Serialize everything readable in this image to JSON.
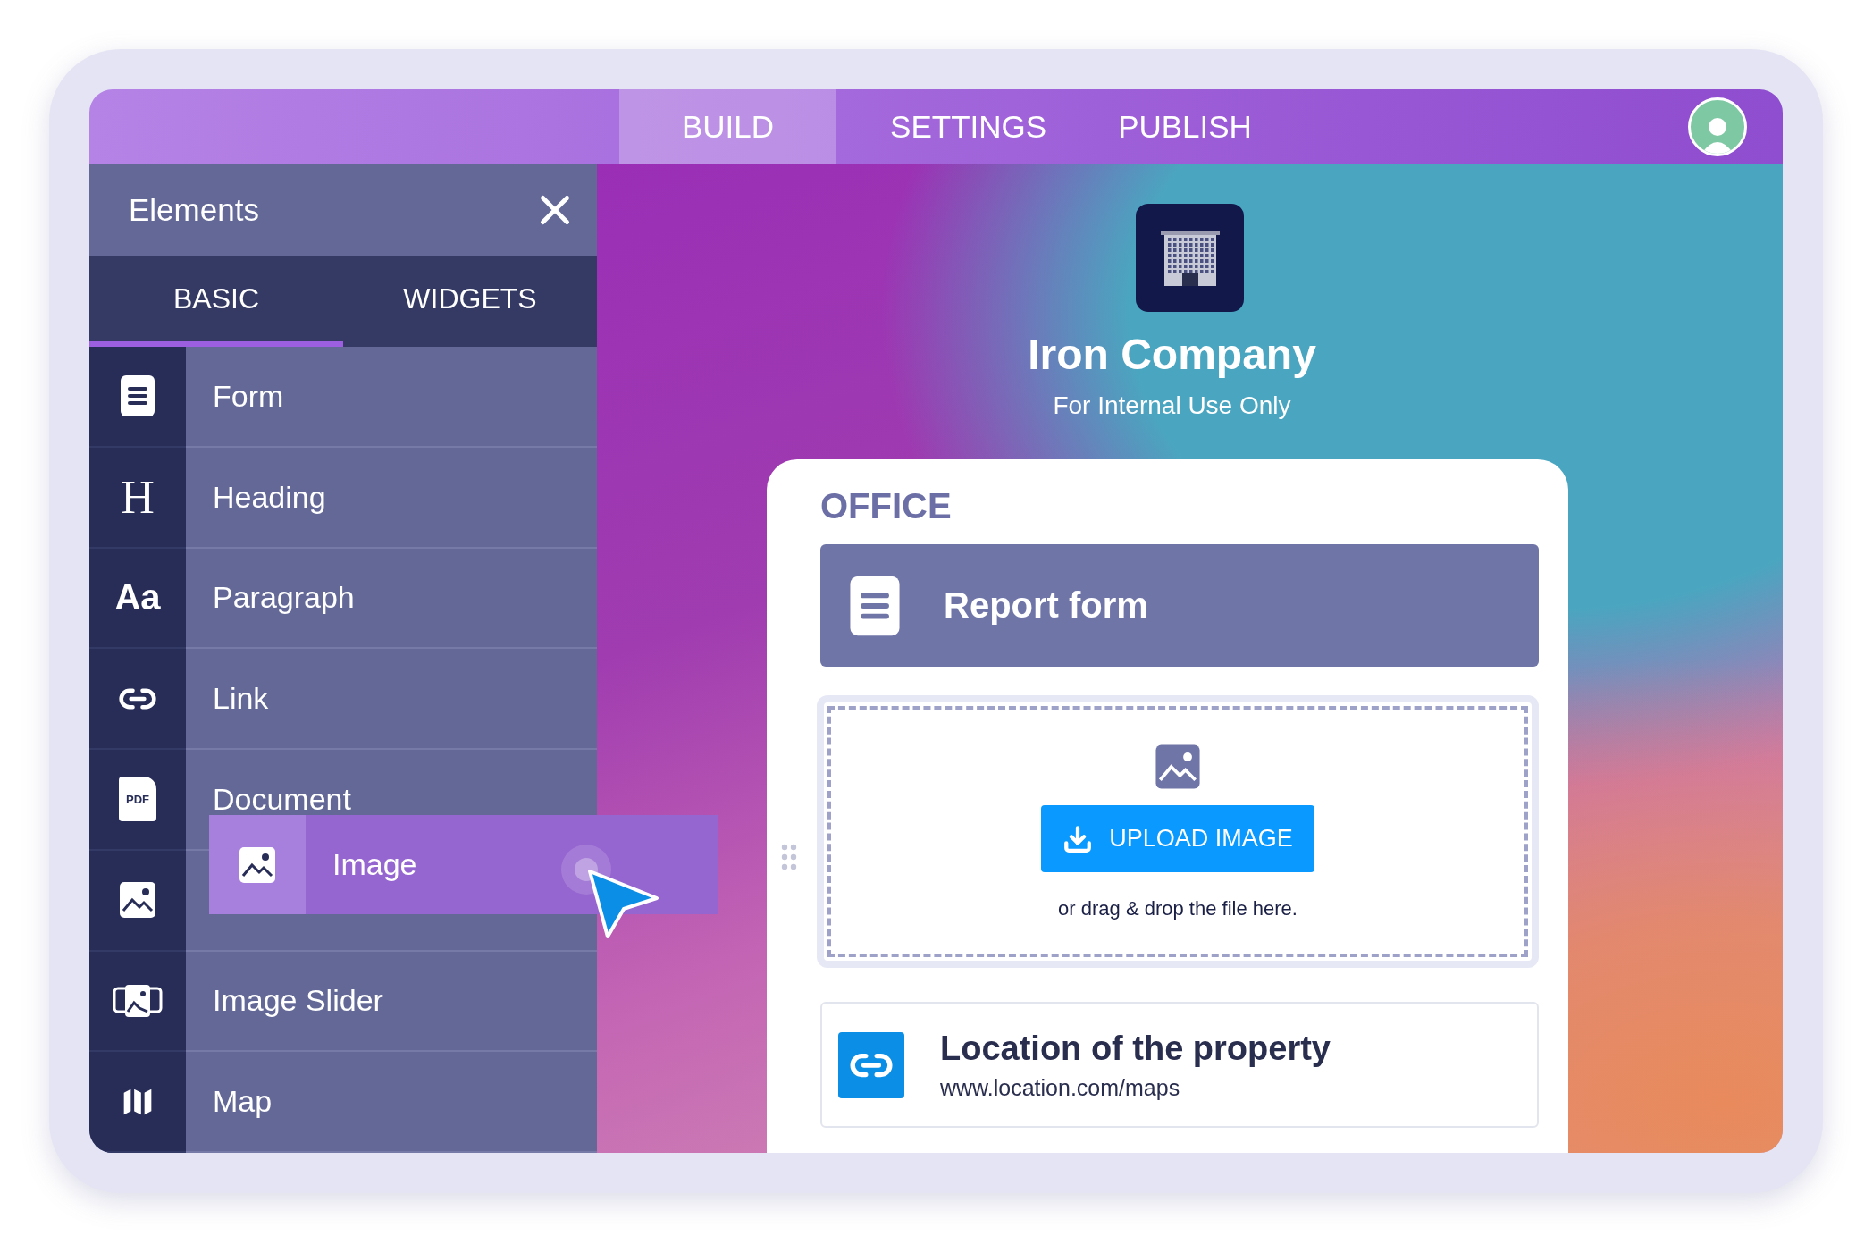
{
  "top_tabs": [
    {
      "label": "BUILD",
      "selected": true
    },
    {
      "label": "SETTINGS",
      "selected": false
    },
    {
      "label": "PUBLISH",
      "selected": false
    }
  ],
  "panel": {
    "title": "Elements",
    "tabs": [
      {
        "label": "BASIC",
        "selected": true
      },
      {
        "label": "WIDGETS",
        "selected": false
      }
    ],
    "items": [
      {
        "kind": "form",
        "label": "Form"
      },
      {
        "kind": "glyph",
        "glyph": "H",
        "label": "Heading"
      },
      {
        "kind": "glyph",
        "glyph": "Aa",
        "label": "Paragraph"
      },
      {
        "kind": "link",
        "label": "Link"
      },
      {
        "kind": "pdf",
        "glyph": "PDF",
        "label": "Document"
      },
      {
        "kind": "image"
      },
      {
        "kind": "slider",
        "label": "Image Slider"
      },
      {
        "kind": "map",
        "label": "Map"
      }
    ]
  },
  "dragged_item": {
    "kind": "image",
    "label": "Image"
  },
  "page": {
    "title": "Iron Company",
    "subtitle": "For Internal Use Only",
    "section": "OFFICE",
    "form_link": {
      "label": "Report form"
    },
    "upload": {
      "button": "UPLOAD IMAGE",
      "hint": "or drag & drop the file here."
    },
    "link": {
      "title": "Location of the property",
      "url": "www.location.com/maps"
    }
  }
}
